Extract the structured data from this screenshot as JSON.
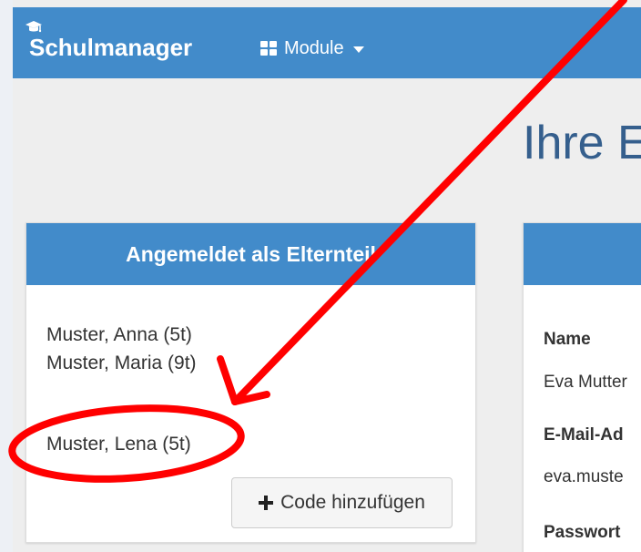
{
  "header": {
    "brand": "Schulmanager",
    "logo_icon": "graduation-cap-icon",
    "module_label": "Module",
    "module_icon": "grid-icon"
  },
  "page_title": "Ihre E",
  "parent_panel": {
    "title": "Angemeldet als Elternteil",
    "students": [
      "Muster, Anna (5t)",
      "Muster, Maria (9t)",
      "Muster, Lena (5t)"
    ],
    "add_code_label": "Code hinzufügen"
  },
  "profile_panel": {
    "name_label": "Name",
    "name_value": "Eva Mutter",
    "email_label": "E-Mail-Ad",
    "email_value": "eva.muste",
    "password_label": "Passwort"
  },
  "colors": {
    "brand_blue": "#428bca",
    "annotation_red": "#ff0000"
  }
}
